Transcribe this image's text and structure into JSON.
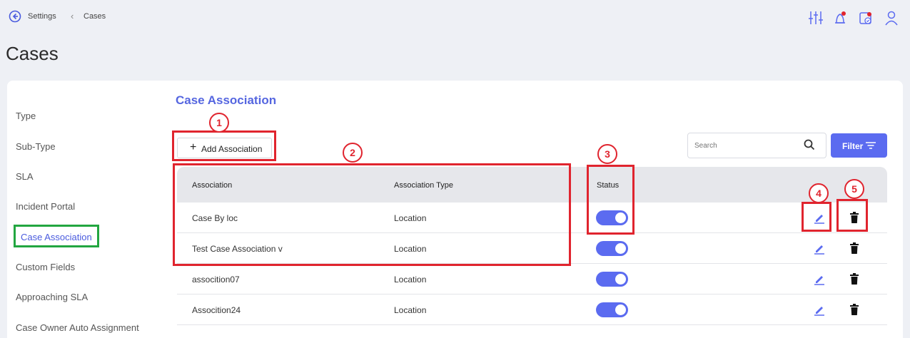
{
  "breadcrumb": {
    "root": "Settings",
    "current": "Cases"
  },
  "page": {
    "title": "Cases"
  },
  "header_icons": [
    "sliders-icon",
    "bell-icon",
    "calendar-check-icon",
    "user-icon"
  ],
  "sidebar": {
    "items": [
      {
        "label": "Type"
      },
      {
        "label": "Sub-Type"
      },
      {
        "label": "SLA"
      },
      {
        "label": "Incident Portal"
      },
      {
        "label": "Case Association",
        "active": true
      },
      {
        "label": "Custom Fields"
      },
      {
        "label": "Approaching SLA"
      },
      {
        "label": "Case Owner Auto Assignment"
      }
    ]
  },
  "section": {
    "title": "Case Association"
  },
  "toolbar": {
    "add_label": "Add Association",
    "search_placeholder": "Search",
    "filter_label": "Filter"
  },
  "table": {
    "columns": [
      "Association",
      "Association Type",
      "Status"
    ],
    "rows": [
      {
        "association": "Case By loc",
        "type": "Location",
        "status": true
      },
      {
        "association": "Test Case Association v",
        "type": "Location",
        "status": true
      },
      {
        "association": "assocition07",
        "type": "Location",
        "status": true
      },
      {
        "association": "Assocition24",
        "type": "Location",
        "status": true
      }
    ]
  },
  "annotations": [
    "1",
    "2",
    "3",
    "4",
    "5"
  ],
  "colors": {
    "accent": "#5b6bf0",
    "annotation": "#e0242e",
    "active_outline": "#22a640"
  }
}
